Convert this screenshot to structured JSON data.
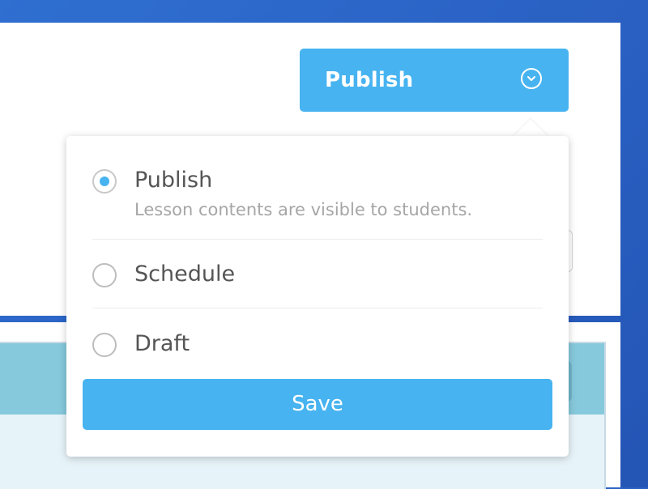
{
  "header": {
    "publish_button_label": "Publish"
  },
  "publish_menu": {
    "options": [
      {
        "label": "Publish",
        "description": "Lesson contents are visible to students.",
        "selected": true
      },
      {
        "label": "Schedule",
        "description": "",
        "selected": false
      },
      {
        "label": "Draft",
        "description": "",
        "selected": false
      }
    ],
    "save_label": "Save"
  },
  "icons": {
    "publish_button_chevron": "chevron-down-circle-icon"
  },
  "colors": {
    "accent": "#47b3f0",
    "background": "#2a62c4",
    "card_header": "#86c9dc"
  }
}
